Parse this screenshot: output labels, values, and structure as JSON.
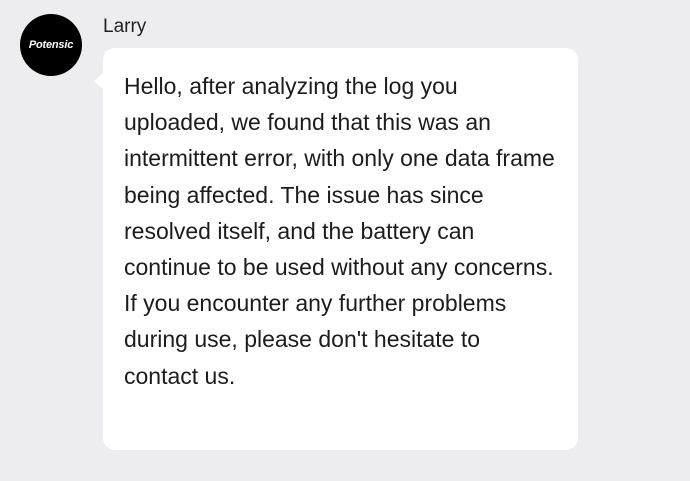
{
  "sender": {
    "name": "Larry",
    "avatar_logo_text": "Potensic",
    "avatar_color": "#000000"
  },
  "message": {
    "paragraphs": [
      "Hello, after analyzing the log you uploaded, we found that this was an intermittent error, with only one data frame being affected. The issue has since resolved itself, and the battery can continue to be used without any concerns.",
      "If you encounter any further problems during use, please don't hesitate to contact us."
    ]
  },
  "colors": {
    "background": "#ededef",
    "bubble": "#ffffff",
    "text": "#1c1c1c"
  }
}
